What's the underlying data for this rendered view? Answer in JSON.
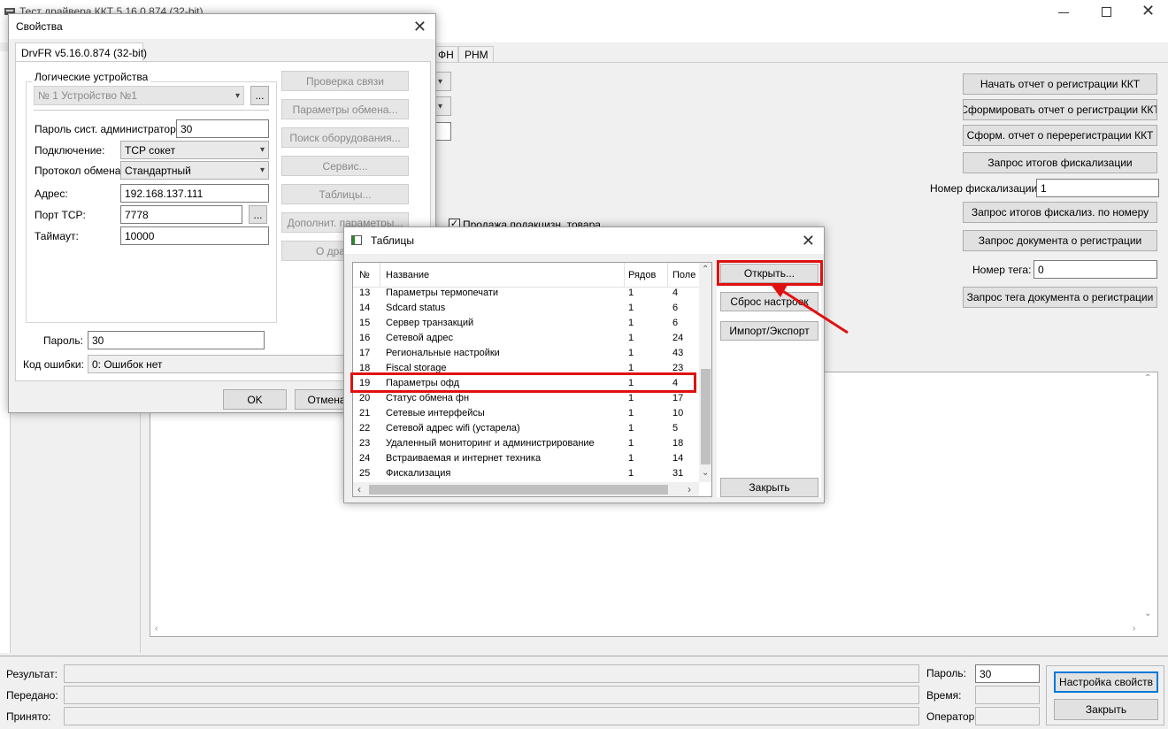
{
  "main_window": {
    "title": "Тест драйвера ККТ 5.16.0.874 (32-bit)",
    "tabs_right": [
      "ФН",
      "РНМ"
    ],
    "buttons": [
      "Начать отчет о регистрации ККТ",
      "Сформировать отчет о регистрации ККТ",
      "Сформ. отчет о перерегистрации ККТ",
      "Запрос итогов фискализации",
      "Запрос итогов фискализ. по номеру",
      "Запрос документа о регистрации",
      "Запрос тега документа о регистрации"
    ],
    "fiscal_number_label": "Номер фискализации:",
    "fiscal_number_value": "1",
    "tag_number_label": "Номер тега:",
    "tag_number_value": "0",
    "excise_checkbox_label": "Продажа подакцизн. товара",
    "bottom": {
      "result_label": "Результат:",
      "sent_label": "Передано:",
      "received_label": "Принято:",
      "password_label": "Пароль:",
      "password_value": "30",
      "time_label": "Время:",
      "operator_label": "Оператор:",
      "settings_button": "Настройка свойств",
      "close_button": "Закрыть"
    }
  },
  "props_dialog": {
    "title": "Свойства",
    "tab": "DrvFR v5.16.0.874 (32-bit)",
    "group_title": "Логические устройства",
    "device_value": "№ 1 Устройство №1",
    "browse": "...",
    "admin_password_label": "Пароль сист. администратора:",
    "admin_password_value": "30",
    "connection_label": "Подключение:",
    "connection_value": "TCP сокет",
    "protocol_label": "Протокол обмена:",
    "protocol_value": "Стандартный",
    "address_label": "Адрес:",
    "address_value": "192.168.137.111",
    "port_label": "Порт TCP:",
    "port_value": "7778",
    "timeout_label": "Таймаут:",
    "timeout_value": "10000",
    "side_buttons": [
      "Проверка связи",
      "Параметры обмена...",
      "Поиск оборудования...",
      "Сервис...",
      "Таблицы...",
      "Дополнит. параметры...",
      "О драйвере"
    ],
    "password_label": "Пароль:",
    "password_value": "30",
    "error_label": "Код ошибки:",
    "error_value": "0: Ошибок нет",
    "ok": "OK",
    "cancel": "Отмена"
  },
  "tables_dialog": {
    "title": "Таблицы",
    "columns": [
      "№",
      "Название",
      "Рядов",
      "Поле"
    ],
    "rows": [
      [
        "13",
        "Параметры термопечати",
        "1",
        "4"
      ],
      [
        "14",
        "Sdcard status",
        "1",
        "6"
      ],
      [
        "15",
        "Сервер транзакций",
        "1",
        "6"
      ],
      [
        "16",
        "Сетевой адрес",
        "1",
        "24"
      ],
      [
        "17",
        "Региональные настройки",
        "1",
        "43"
      ],
      [
        "18",
        "Fiscal storage",
        "1",
        "23"
      ],
      [
        "19",
        "Параметры офд",
        "1",
        "4"
      ],
      [
        "20",
        "Статус обмена фн",
        "1",
        "17"
      ],
      [
        "21",
        "Сетевые интерфейсы",
        "1",
        "10"
      ],
      [
        "22",
        "Сетевой адрес wifi (устарела)",
        "1",
        "5"
      ],
      [
        "23",
        "Удаленный мониторинг и администрирование",
        "1",
        "18"
      ],
      [
        "24",
        "Встраиваемая и интернет техника",
        "1",
        "14"
      ],
      [
        "25",
        "Фискализация",
        "1",
        "31"
      ]
    ],
    "buttons": {
      "open": "Открыть...",
      "reset": "Сброс настроек",
      "import_export": "Импорт/Экспорт",
      "close": "Закрыть"
    }
  },
  "colors": {
    "highlight": "#e01010",
    "title_bg": "#ffffff",
    "face": "#f0f0f0"
  }
}
